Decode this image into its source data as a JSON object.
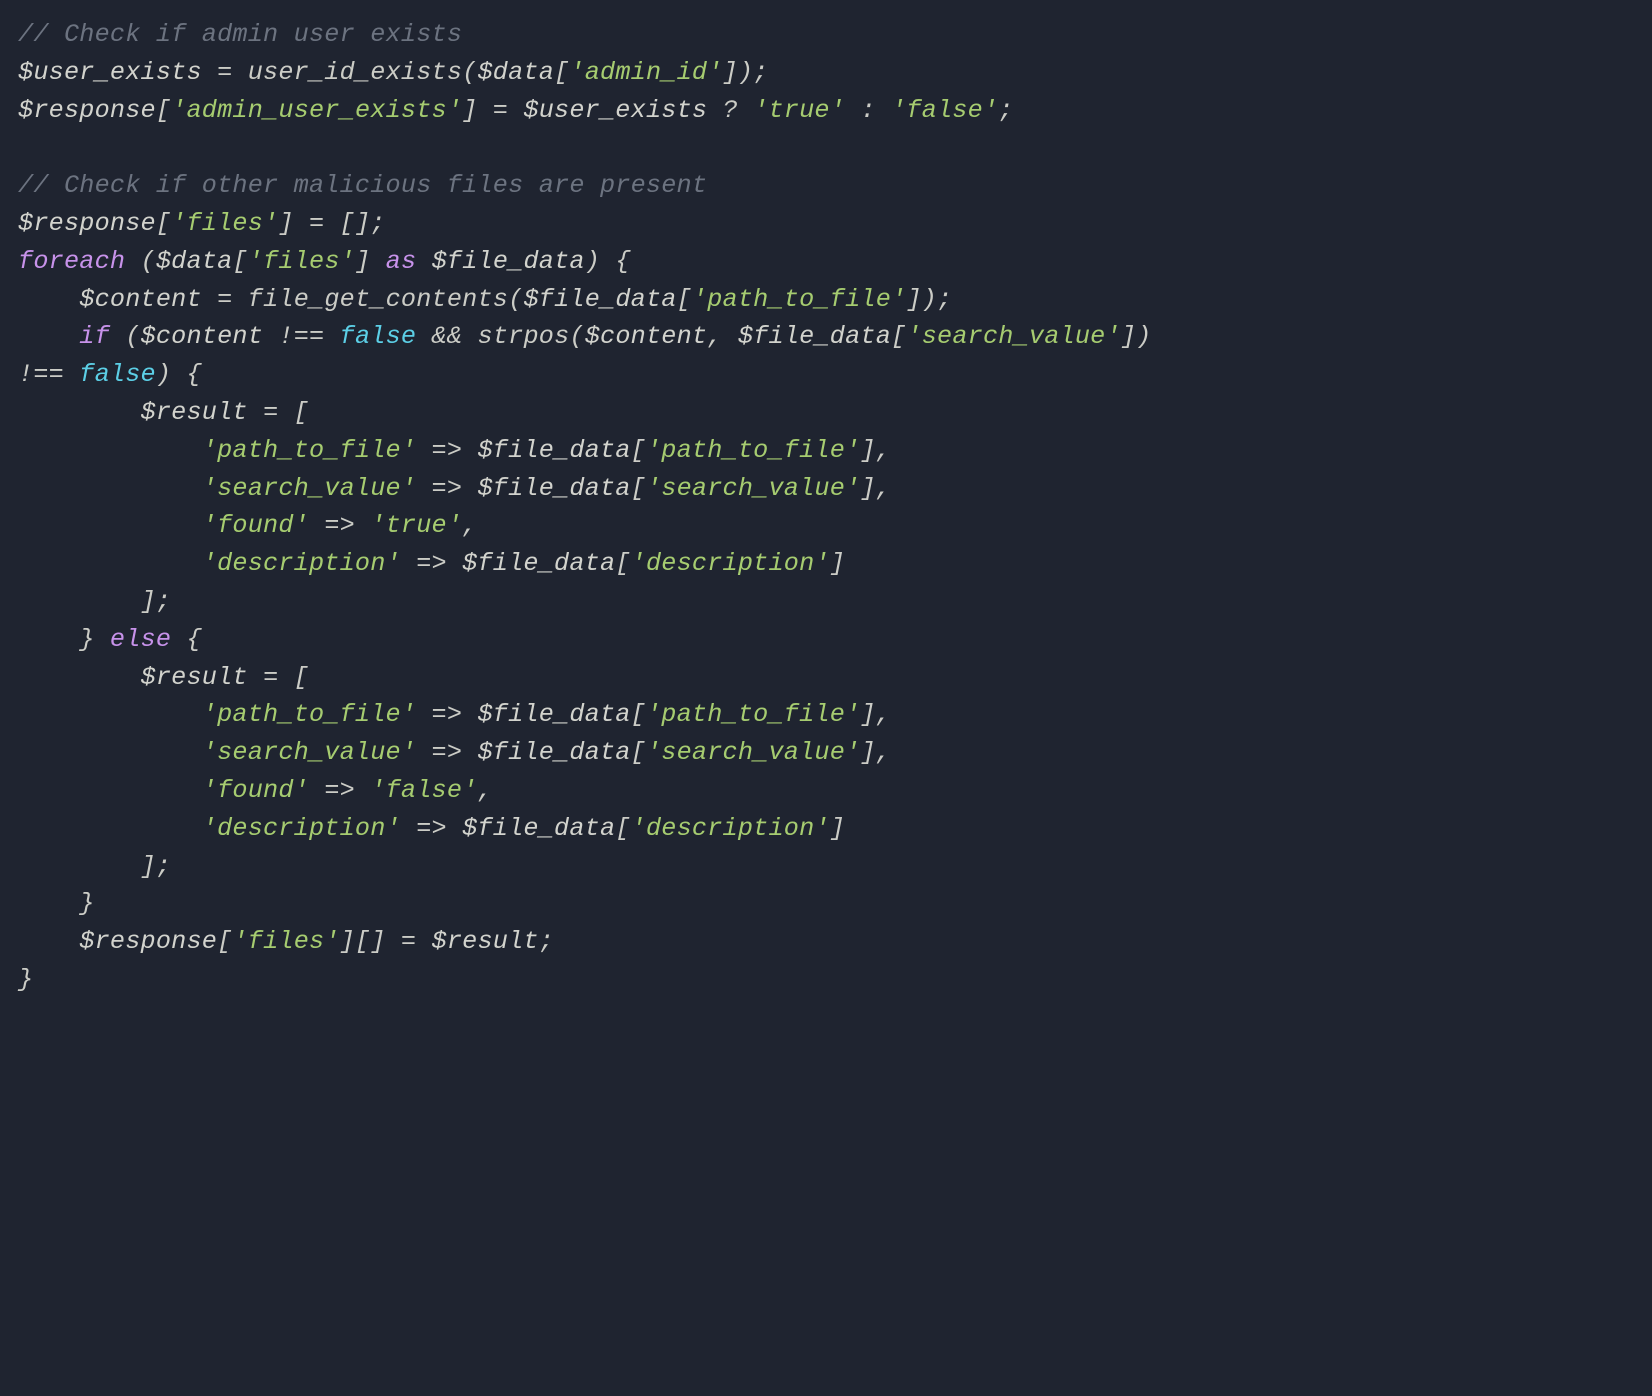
{
  "code": {
    "tokens": [
      {
        "cls": "tok-comment",
        "text": "// Check if admin user exists"
      },
      {
        "cls": null,
        "text": "\n"
      },
      {
        "cls": "tok-var",
        "text": "$user_exists"
      },
      {
        "cls": "tok-plain",
        "text": " = "
      },
      {
        "cls": "tok-func",
        "text": "user_id_exists"
      },
      {
        "cls": "tok-plain",
        "text": "("
      },
      {
        "cls": "tok-var",
        "text": "$data"
      },
      {
        "cls": "tok-plain",
        "text": "["
      },
      {
        "cls": "tok-str",
        "text": "'admin_id'"
      },
      {
        "cls": "tok-plain",
        "text": "]);"
      },
      {
        "cls": null,
        "text": "\n"
      },
      {
        "cls": "tok-var",
        "text": "$response"
      },
      {
        "cls": "tok-plain",
        "text": "["
      },
      {
        "cls": "tok-str",
        "text": "'admin_user_exists'"
      },
      {
        "cls": "tok-plain",
        "text": "] = "
      },
      {
        "cls": "tok-var",
        "text": "$user_exists"
      },
      {
        "cls": "tok-plain",
        "text": " ? "
      },
      {
        "cls": "tok-str",
        "text": "'true'"
      },
      {
        "cls": "tok-plain",
        "text": " : "
      },
      {
        "cls": "tok-str",
        "text": "'false'"
      },
      {
        "cls": "tok-plain",
        "text": ";"
      },
      {
        "cls": null,
        "text": "\n"
      },
      {
        "cls": null,
        "text": "\n"
      },
      {
        "cls": "tok-comment",
        "text": "// Check if other malicious files are present"
      },
      {
        "cls": null,
        "text": "\n"
      },
      {
        "cls": "tok-var",
        "text": "$response"
      },
      {
        "cls": "tok-plain",
        "text": "["
      },
      {
        "cls": "tok-str",
        "text": "'files'"
      },
      {
        "cls": "tok-plain",
        "text": "] = [];"
      },
      {
        "cls": null,
        "text": "\n"
      },
      {
        "cls": "tok-kw",
        "text": "foreach"
      },
      {
        "cls": "tok-plain",
        "text": " ("
      },
      {
        "cls": "tok-var",
        "text": "$data"
      },
      {
        "cls": "tok-plain",
        "text": "["
      },
      {
        "cls": "tok-str",
        "text": "'files'"
      },
      {
        "cls": "tok-plain",
        "text": "] "
      },
      {
        "cls": "tok-kw",
        "text": "as"
      },
      {
        "cls": "tok-plain",
        "text": " "
      },
      {
        "cls": "tok-var",
        "text": "$file_data"
      },
      {
        "cls": "tok-plain",
        "text": ") {"
      },
      {
        "cls": null,
        "text": "\n"
      },
      {
        "cls": "tok-plain",
        "text": "    "
      },
      {
        "cls": "tok-var",
        "text": "$content"
      },
      {
        "cls": "tok-plain",
        "text": " = "
      },
      {
        "cls": "tok-func",
        "text": "file_get_contents"
      },
      {
        "cls": "tok-plain",
        "text": "("
      },
      {
        "cls": "tok-var",
        "text": "$file_data"
      },
      {
        "cls": "tok-plain",
        "text": "["
      },
      {
        "cls": "tok-str",
        "text": "'path_to_file'"
      },
      {
        "cls": "tok-plain",
        "text": "]);"
      },
      {
        "cls": null,
        "text": "\n"
      },
      {
        "cls": "tok-plain",
        "text": "    "
      },
      {
        "cls": "tok-kw",
        "text": "if"
      },
      {
        "cls": "tok-plain",
        "text": " ("
      },
      {
        "cls": "tok-var",
        "text": "$content"
      },
      {
        "cls": "tok-plain",
        "text": " !== "
      },
      {
        "cls": "tok-bool",
        "text": "false"
      },
      {
        "cls": "tok-plain",
        "text": " && "
      },
      {
        "cls": "tok-func",
        "text": "strpos"
      },
      {
        "cls": "tok-plain",
        "text": "("
      },
      {
        "cls": "tok-var",
        "text": "$content"
      },
      {
        "cls": "tok-plain",
        "text": ", "
      },
      {
        "cls": "tok-var",
        "text": "$file_data"
      },
      {
        "cls": "tok-plain",
        "text": "["
      },
      {
        "cls": "tok-str",
        "text": "'search_value'"
      },
      {
        "cls": "tok-plain",
        "text": "]) "
      },
      {
        "cls": null,
        "text": "\n"
      },
      {
        "cls": "tok-plain",
        "text": "!== "
      },
      {
        "cls": "tok-bool",
        "text": "false"
      },
      {
        "cls": "tok-plain",
        "text": ") {"
      },
      {
        "cls": null,
        "text": "\n"
      },
      {
        "cls": "tok-plain",
        "text": "        "
      },
      {
        "cls": "tok-var",
        "text": "$result"
      },
      {
        "cls": "tok-plain",
        "text": " = ["
      },
      {
        "cls": null,
        "text": "\n"
      },
      {
        "cls": "tok-plain",
        "text": "            "
      },
      {
        "cls": "tok-str",
        "text": "'path_to_file'"
      },
      {
        "cls": "tok-plain",
        "text": " => "
      },
      {
        "cls": "tok-var",
        "text": "$file_data"
      },
      {
        "cls": "tok-plain",
        "text": "["
      },
      {
        "cls": "tok-str",
        "text": "'path_to_file'"
      },
      {
        "cls": "tok-plain",
        "text": "],"
      },
      {
        "cls": null,
        "text": "\n"
      },
      {
        "cls": "tok-plain",
        "text": "            "
      },
      {
        "cls": "tok-str",
        "text": "'search_value'"
      },
      {
        "cls": "tok-plain",
        "text": " => "
      },
      {
        "cls": "tok-var",
        "text": "$file_data"
      },
      {
        "cls": "tok-plain",
        "text": "["
      },
      {
        "cls": "tok-str",
        "text": "'search_value'"
      },
      {
        "cls": "tok-plain",
        "text": "],"
      },
      {
        "cls": null,
        "text": "\n"
      },
      {
        "cls": "tok-plain",
        "text": "            "
      },
      {
        "cls": "tok-str",
        "text": "'found'"
      },
      {
        "cls": "tok-plain",
        "text": " => "
      },
      {
        "cls": "tok-str",
        "text": "'true'"
      },
      {
        "cls": "tok-plain",
        "text": ","
      },
      {
        "cls": null,
        "text": "\n"
      },
      {
        "cls": "tok-plain",
        "text": "            "
      },
      {
        "cls": "tok-str",
        "text": "'description'"
      },
      {
        "cls": "tok-plain",
        "text": " => "
      },
      {
        "cls": "tok-var",
        "text": "$file_data"
      },
      {
        "cls": "tok-plain",
        "text": "["
      },
      {
        "cls": "tok-str",
        "text": "'description'"
      },
      {
        "cls": "tok-plain",
        "text": "]"
      },
      {
        "cls": null,
        "text": "\n"
      },
      {
        "cls": "tok-plain",
        "text": "        ];"
      },
      {
        "cls": null,
        "text": "\n"
      },
      {
        "cls": "tok-plain",
        "text": "    } "
      },
      {
        "cls": "tok-kw",
        "text": "else"
      },
      {
        "cls": "tok-plain",
        "text": " {"
      },
      {
        "cls": null,
        "text": "\n"
      },
      {
        "cls": "tok-plain",
        "text": "        "
      },
      {
        "cls": "tok-var",
        "text": "$result"
      },
      {
        "cls": "tok-plain",
        "text": " = ["
      },
      {
        "cls": null,
        "text": "\n"
      },
      {
        "cls": "tok-plain",
        "text": "            "
      },
      {
        "cls": "tok-str",
        "text": "'path_to_file'"
      },
      {
        "cls": "tok-plain",
        "text": " => "
      },
      {
        "cls": "tok-var",
        "text": "$file_data"
      },
      {
        "cls": "tok-plain",
        "text": "["
      },
      {
        "cls": "tok-str",
        "text": "'path_to_file'"
      },
      {
        "cls": "tok-plain",
        "text": "],"
      },
      {
        "cls": null,
        "text": "\n"
      },
      {
        "cls": "tok-plain",
        "text": "            "
      },
      {
        "cls": "tok-str",
        "text": "'search_value'"
      },
      {
        "cls": "tok-plain",
        "text": " => "
      },
      {
        "cls": "tok-var",
        "text": "$file_data"
      },
      {
        "cls": "tok-plain",
        "text": "["
      },
      {
        "cls": "tok-str",
        "text": "'search_value'"
      },
      {
        "cls": "tok-plain",
        "text": "],"
      },
      {
        "cls": null,
        "text": "\n"
      },
      {
        "cls": "tok-plain",
        "text": "            "
      },
      {
        "cls": "tok-str",
        "text": "'found'"
      },
      {
        "cls": "tok-plain",
        "text": " => "
      },
      {
        "cls": "tok-str",
        "text": "'false'"
      },
      {
        "cls": "tok-plain",
        "text": ","
      },
      {
        "cls": null,
        "text": "\n"
      },
      {
        "cls": "tok-plain",
        "text": "            "
      },
      {
        "cls": "tok-str",
        "text": "'description'"
      },
      {
        "cls": "tok-plain",
        "text": " => "
      },
      {
        "cls": "tok-var",
        "text": "$file_data"
      },
      {
        "cls": "tok-plain",
        "text": "["
      },
      {
        "cls": "tok-str",
        "text": "'description'"
      },
      {
        "cls": "tok-plain",
        "text": "]"
      },
      {
        "cls": null,
        "text": "\n"
      },
      {
        "cls": "tok-plain",
        "text": "        ];"
      },
      {
        "cls": null,
        "text": "\n"
      },
      {
        "cls": "tok-plain",
        "text": "    }"
      },
      {
        "cls": null,
        "text": "\n"
      },
      {
        "cls": "tok-plain",
        "text": "    "
      },
      {
        "cls": "tok-var",
        "text": "$response"
      },
      {
        "cls": "tok-plain",
        "text": "["
      },
      {
        "cls": "tok-str",
        "text": "'files'"
      },
      {
        "cls": "tok-plain",
        "text": "][] = "
      },
      {
        "cls": "tok-var",
        "text": "$result"
      },
      {
        "cls": "tok-plain",
        "text": ";"
      },
      {
        "cls": null,
        "text": "\n"
      },
      {
        "cls": "tok-plain",
        "text": "}"
      }
    ]
  }
}
